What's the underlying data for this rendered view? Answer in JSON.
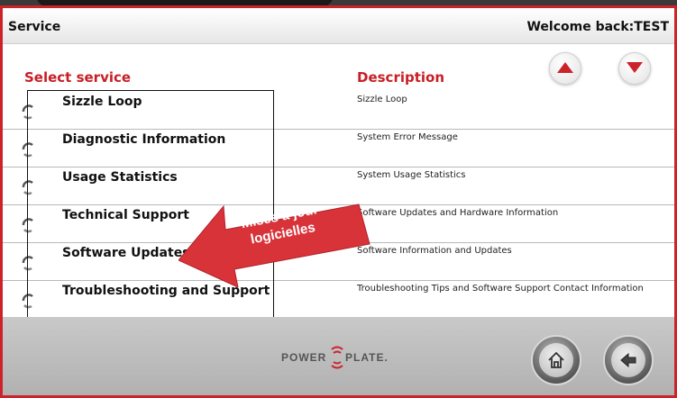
{
  "header": {
    "title": "Service",
    "welcome": "Welcome back:TEST"
  },
  "columns": {
    "select": "Select service",
    "description": "Description"
  },
  "services": [
    {
      "name": "Sizzle Loop",
      "description": "Sizzle Loop"
    },
    {
      "name": "Diagnostic Information",
      "description": "System Error Message"
    },
    {
      "name": "Usage Statistics",
      "description": "System Usage Statistics"
    },
    {
      "name": "Technical Support",
      "description": "Software Updates and Hardware Information"
    },
    {
      "name": "Software Updates",
      "description": "Software Information and Updates"
    },
    {
      "name": "Troubleshooting and Support",
      "description": "Troubleshooting Tips and Software Support Contact Information"
    }
  ],
  "annotation": {
    "line1": "Mises à jour",
    "line2": "logicielles"
  },
  "logo": {
    "left": "POWER",
    "right": "PLATE."
  },
  "icons": {
    "up": "arrow-up-icon",
    "down": "arrow-down-icon",
    "home": "home-icon",
    "back": "back-arrow-icon",
    "row": "loading-spinner-icon"
  },
  "colors": {
    "accent": "#cc2229",
    "banner": "#d9333a"
  }
}
